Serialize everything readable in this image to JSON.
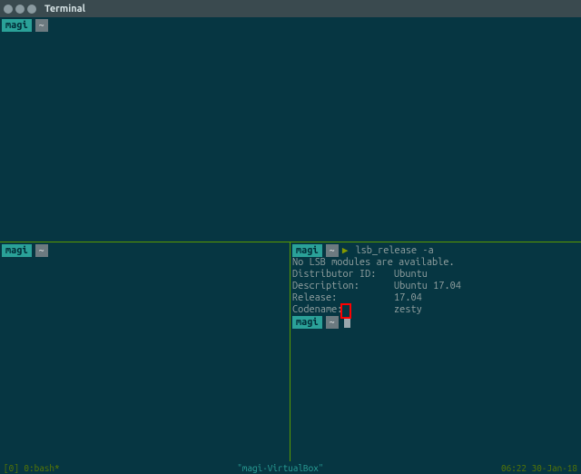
{
  "window": {
    "title": "Terminal"
  },
  "prompt": {
    "user": "magi",
    "dir": "~"
  },
  "panes": {
    "top": {
      "command": ""
    },
    "bl": {
      "command": ""
    },
    "br": {
      "command": "lsb_release -a",
      "output": {
        "no_modules": "No LSB modules are available.",
        "rows": [
          {
            "k": "Distributor ID:",
            "v": "Ubuntu"
          },
          {
            "k": "Description:",
            "v": "Ubuntu 17.04"
          },
          {
            "k": "Release:",
            "v": "17.04"
          },
          {
            "k": "Codename:",
            "v": "zesty"
          }
        ]
      }
    }
  },
  "status": {
    "left": "[0] 0:bash*",
    "mid": "\"magi-VirtualBox\"",
    "right": "06:22 30-Jan-18"
  }
}
